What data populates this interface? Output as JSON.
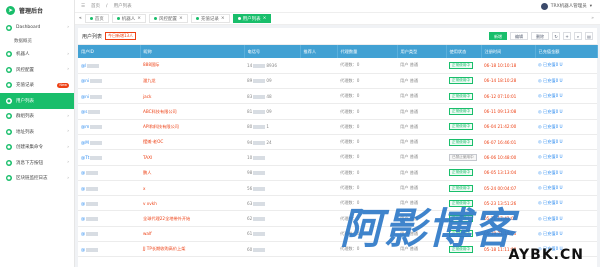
{
  "app": {
    "title": "管理后台"
  },
  "sidebar": {
    "items": [
      {
        "label": "Dashboard",
        "icon": "dashboard-icon",
        "has_caret": true
      },
      {
        "label": "数据概览",
        "sub": true
      },
      {
        "label": "机器人",
        "icon": "robot-icon",
        "has_caret": true
      },
      {
        "label": "风控配置",
        "icon": "shield-icon",
        "has_caret": true
      },
      {
        "label": "充值记录",
        "icon": "record-icon",
        "badge": "New"
      },
      {
        "label": "用户列表",
        "icon": "user-icon",
        "active": true
      },
      {
        "label": "群组列表",
        "icon": "group-icon",
        "has_caret": true
      },
      {
        "label": "地址列表",
        "icon": "address-icon",
        "has_caret": true
      },
      {
        "label": "创建采集命令",
        "icon": "command-icon",
        "has_caret": true
      },
      {
        "label": "消息下方按钮",
        "icon": "button-icon",
        "has_caret": true
      },
      {
        "label": "区块链监控日志",
        "icon": "chain-icon",
        "has_caret": true
      }
    ]
  },
  "topbar": {
    "breadcrumb": [
      "首页",
      "用户列表"
    ],
    "user_name": "TRX机器人管理员"
  },
  "tabs": [
    {
      "label": "首页"
    },
    {
      "label": "机器人"
    },
    {
      "label": "风控配置"
    },
    {
      "label": "充值记录"
    },
    {
      "label": "用户列表",
      "active": true
    }
  ],
  "panel": {
    "title": "用户列表",
    "hint": "今日新增13人",
    "actions": {
      "add": "新增",
      "edit": "编辑",
      "delete": "删除"
    }
  },
  "table": {
    "columns": [
      "用户ID",
      "昵称",
      "电话号",
      "推荐人",
      "代理数量",
      "用户类型",
      "使用状态",
      "注册时间",
      "已充值金额"
    ],
    "rows": [
      {
        "id": "@l",
        "nick": "888国际",
        "phone": "14",
        "phone2": "8936",
        "agent": "代理数：0",
        "type": "用户 普通",
        "status": "正常使用中",
        "time": "06-18 10:10:18",
        "amount": "已充值0 U"
      },
      {
        "id": "@ni",
        "nick": "潘九龙",
        "phone": "89",
        "phone2": "09",
        "agent": "代理数：0",
        "type": "用户 普通",
        "status": "正常使用中",
        "time": "06-14 18:10:28",
        "amount": "已充值0 U"
      },
      {
        "id": "@ni",
        "nick": "jack",
        "phone": "83",
        "phone2": "48",
        "agent": "代理数：0",
        "type": "用户 普通",
        "status": "正常使用中",
        "time": "06-12 07:10:01",
        "amount": "已充值0 U"
      },
      {
        "id": "@s",
        "nick": "ABC科技有限公司",
        "phone": "81",
        "phone2": "09",
        "agent": "代理数：0",
        "type": "用户 普通",
        "status": "正常使用中",
        "time": "06-11 09:13:08",
        "amount": "已充值0 U"
      },
      {
        "id": "@m",
        "nick": "API和科技有限公司",
        "phone": "80",
        "phone2": "1",
        "agent": "代理数：0",
        "type": "用户 普通",
        "status": "正常使用中",
        "time": "06-04 21:42:00",
        "amount": "已充值0 U"
      },
      {
        "id": "@M",
        "nick": "摆摊-老OC",
        "phone": "94",
        "phone2": "24",
        "agent": "代理数：0",
        "type": "用户 普通",
        "status": "正常使用中",
        "time": "06-07 16:46:01",
        "amount": "已充值0 U"
      },
      {
        "id": "@Tt",
        "nick": "TAXI",
        "phone": "10",
        "phone2": "",
        "agent": "代理数：0",
        "type": "用户 普通",
        "status": "已禁止使用中",
        "time": "06-06 10:48:00",
        "amount": "已充值0 U"
      },
      {
        "id": "@",
        "nick": "鹏人",
        "phone": "98",
        "phone2": "",
        "agent": "代理数：0",
        "type": "用户 普通",
        "status": "正常使用中",
        "time": "06-05 13:13:04",
        "amount": "已充值0 U"
      },
      {
        "id": "@",
        "nick": "x",
        "phone": "56",
        "phone2": "",
        "agent": "代理数：0",
        "type": "用户 普通",
        "status": "正常使用中",
        "time": "05-24 00:04:07",
        "amount": "已充值0 U"
      },
      {
        "id": "@",
        "nick": "v xvkh",
        "phone": "63",
        "phone2": "",
        "agent": "代理数：0",
        "type": "用户 普通",
        "status": "正常使用中",
        "time": "05-23 13:51:26",
        "amount": "已充值0 U"
      },
      {
        "id": "@",
        "nick": "全球代理22全地带外开始",
        "phone": "62",
        "phone2": "",
        "agent": "代理数：0",
        "type": "用户 普通",
        "status": "正常使用中",
        "time": "05-21 17:42:05",
        "amount": "已充值0 U"
      },
      {
        "id": "@",
        "nick": "walf",
        "phone": "61",
        "phone2": "",
        "agent": "代理数：0",
        "type": "用户 普通",
        "status": "正常使用中",
        "time": "05-19 21:10:05",
        "amount": "已充值0 U"
      },
      {
        "id": "@",
        "nick": "JJ TP长期收购高价上架",
        "phone": "60",
        "phone2": "",
        "agent": "代理数：0",
        "type": "用户 普通",
        "status": "正常使用中",
        "time": "05-18 11:11:08",
        "amount": "已充值0 U"
      }
    ]
  },
  "watermark": {
    "big": "阿影博客",
    "small": "AYBK.CN"
  },
  "colors": {
    "accent": "#19be6b",
    "header": "#42a1d3",
    "danger": "#ed4014",
    "link": "#2d8cf0"
  }
}
